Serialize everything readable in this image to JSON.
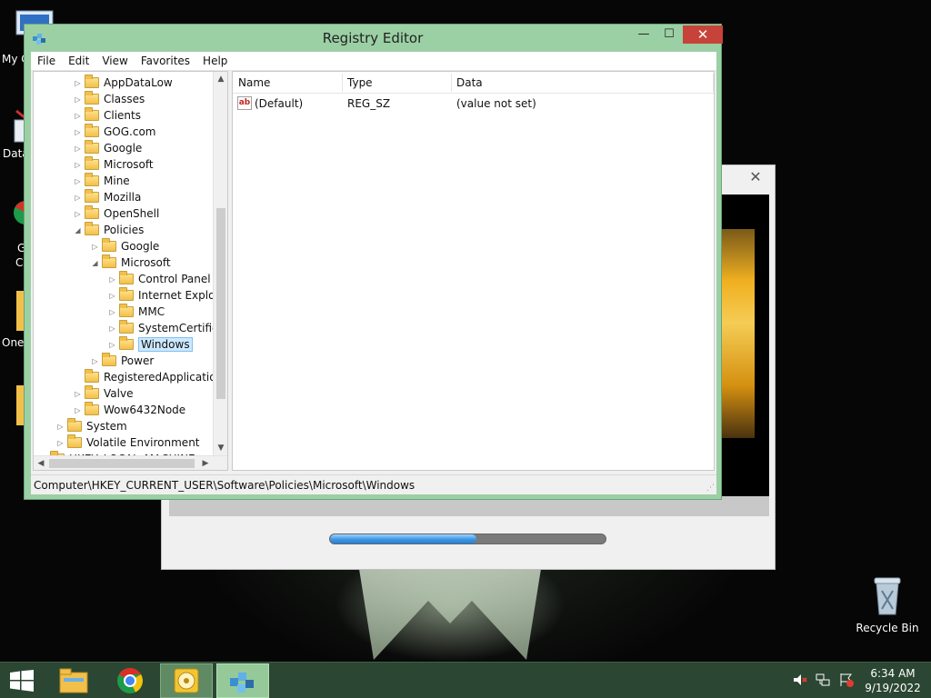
{
  "window": {
    "title": "Registry Editor",
    "minimize": "—",
    "maximize": "☐",
    "close": "✕"
  },
  "menu": [
    "File",
    "Edit",
    "View",
    "Favorites",
    "Help"
  ],
  "tree": {
    "rows": [
      {
        "label": "AppDataLow",
        "level": 2,
        "exp": "▷"
      },
      {
        "label": "Classes",
        "level": 2,
        "exp": "▷"
      },
      {
        "label": "Clients",
        "level": 2,
        "exp": "▷"
      },
      {
        "label": "GOG.com",
        "level": 2,
        "exp": "▷"
      },
      {
        "label": "Google",
        "level": 2,
        "exp": "▷"
      },
      {
        "label": "Microsoft",
        "level": 2,
        "exp": "▷"
      },
      {
        "label": "Mine",
        "level": 2,
        "exp": "▷"
      },
      {
        "label": "Mozilla",
        "level": 2,
        "exp": "▷"
      },
      {
        "label": "OpenShell",
        "level": 2,
        "exp": "▷"
      },
      {
        "label": "Policies",
        "level": 2,
        "exp": "◢"
      },
      {
        "label": "Google",
        "level": 3,
        "exp": "▷"
      },
      {
        "label": "Microsoft",
        "level": 3,
        "exp": "◢"
      },
      {
        "label": "Control Panel",
        "level": 4,
        "exp": "▷"
      },
      {
        "label": "Internet Explorer",
        "level": 4,
        "exp": "▷"
      },
      {
        "label": "MMC",
        "level": 4,
        "exp": "▷"
      },
      {
        "label": "SystemCertificates",
        "level": 4,
        "exp": "▷"
      },
      {
        "label": "Windows",
        "level": 4,
        "exp": "▷",
        "selected": true
      },
      {
        "label": "Power",
        "level": 3,
        "exp": "▷"
      },
      {
        "label": "RegisteredApplications",
        "level": 2,
        "exp": ""
      },
      {
        "label": "Valve",
        "level": 2,
        "exp": "▷"
      },
      {
        "label": "Wow6432Node",
        "level": 2,
        "exp": "▷"
      },
      {
        "label": "System",
        "level": 1,
        "exp": "▷"
      },
      {
        "label": "Volatile Environment",
        "level": 1,
        "exp": "▷"
      },
      {
        "label": "HKEY_LOCAL_MACHINE",
        "level": 0,
        "exp": "▷"
      }
    ]
  },
  "list": {
    "columns": [
      "Name",
      "Type",
      "Data"
    ],
    "rows": [
      {
        "name": "(Default)",
        "type": "REG_SZ",
        "data": "(value not set)"
      }
    ]
  },
  "status": {
    "path": "Computer\\HKEY_CURRENT_USER\\Software\\Policies\\Microsoft\\Windows"
  },
  "dialog": {
    "progress": 0.53,
    "close": "✕"
  },
  "desktop": {
    "recycle_bin": "Recycle Bin",
    "partial_labels": [
      "My C",
      "Data",
      "G",
      "C",
      "One"
    ]
  },
  "taskbar": {
    "time": "6:34 AM",
    "date": "9/19/2022",
    "apps": [
      "file-explorer-icon",
      "chrome-icon",
      "disc-app-icon",
      "registry-editor-icon"
    ]
  },
  "colors": {
    "window_frame": "#9bd0a4",
    "close_button": "#c7433a",
    "taskbar": "#2b4632",
    "selection": "#cce8ff",
    "progress": "#3b96e6"
  }
}
